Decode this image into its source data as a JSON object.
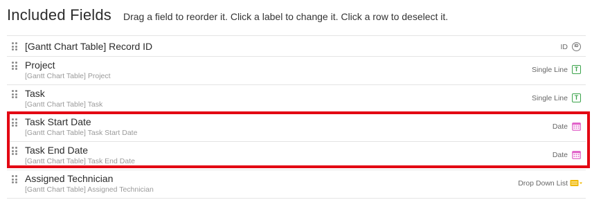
{
  "header": {
    "title": "Included Fields",
    "instructions": "Drag a field to reorder it. Click a label to change it. Click a row to deselect it."
  },
  "rows": [
    {
      "label": "[Gantt Chart Table] Record ID",
      "sublabel": "",
      "type": "ID",
      "icon": "id-icon",
      "icon_color": "#777777"
    },
    {
      "label": "Project",
      "sublabel": "[Gantt Chart Table] Project",
      "type": "Single Line",
      "icon": "text-field-icon",
      "icon_color": "#3aa34a"
    },
    {
      "label": "Task",
      "sublabel": "[Gantt Chart Table] Task",
      "type": "Single Line",
      "icon": "text-field-icon",
      "icon_color": "#3aa34a"
    },
    {
      "label": "Task Start Date",
      "sublabel": "[Gantt Chart Table] Task Start Date",
      "type": "Date",
      "icon": "calendar-icon",
      "icon_color": "#e05fc8"
    },
    {
      "label": "Task End Date",
      "sublabel": "[Gantt Chart Table] Task End Date",
      "type": "Date",
      "icon": "calendar-icon",
      "icon_color": "#e05fc8"
    },
    {
      "label": "Assigned Technician",
      "sublabel": "[Gantt Chart Table] Assigned Technician",
      "type": "Drop Down List",
      "icon": "dropdown-list-icon",
      "icon_color": "#f0b800"
    }
  ],
  "colors": {
    "highlight": "#e30613",
    "row_border": "#e4e4e4"
  }
}
